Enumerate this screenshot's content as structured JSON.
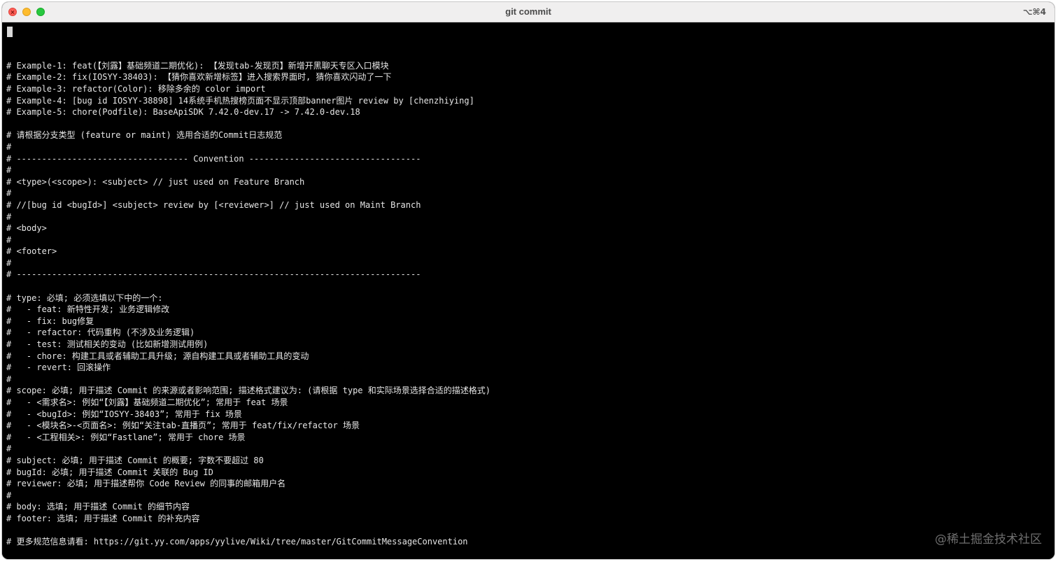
{
  "window": {
    "title": "git commit",
    "shortcut": "⌥⌘4"
  },
  "terminal": {
    "lines": [
      "",
      "",
      "# Example-1: feat(【刘露】基础频道二期优化): 【发现tab-发现页】新增开黑聊天专区入口模块",
      "# Example-2: fix(IOSYY-38403): 【猜你喜欢新增标签】进入搜索界面时, 猜你喜欢闪动了一下",
      "# Example-3: refactor(Color): 移除多余的 color import",
      "# Example-4: [bug id IOSYY-38898] 14系统手机热搜榜页面不显示顶部banner图片 review by [chenzhiying]",
      "# Example-5: chore(Podfile): BaseApiSDK 7.42.0-dev.17 -> 7.42.0-dev.18",
      "",
      "# 请根据分支类型 (feature or maint) 选用合适的Commit日志规范",
      "#",
      "# ---------------------------------- Convention ----------------------------------",
      "#",
      "# <type>(<scope>): <subject> // just used on Feature Branch",
      "#",
      "# //[bug id <bugId>] <subject> review by [<reviewer>] // just used on Maint Branch",
      "#",
      "# <body>",
      "#",
      "# <footer>",
      "#",
      "# --------------------------------------------------------------------------------",
      "",
      "# type: 必填; 必须选填以下中的一个:",
      "#   - feat: 新特性开发; 业务逻辑修改",
      "#   - fix: bug修复",
      "#   - refactor: 代码重构 (不涉及业务逻辑)",
      "#   - test: 测试相关的变动 (比如新增测试用例)",
      "#   - chore: 构建工具或者辅助工具升级; 源自构建工具或者辅助工具的变动",
      "#   - revert: 回滚操作",
      "#",
      "# scope: 必填; 用于描述 Commit 的来源或者影响范围; 描述格式建议为: (请根据 type 和实际场景选择合适的描述格式)",
      "#   - <需求名>: 例如“【刘露】基础频道二期优化”; 常用于 feat 场景",
      "#   - <bugId>: 例如“IOSYY-38403”; 常用于 fix 场景",
      "#   - <模块名>-<页面名>: 例如“关注tab-直播页”; 常用于 feat/fix/refactor 场景",
      "#   - <工程相关>: 例如“Fastlane”; 常用于 chore 场景",
      "#",
      "# subject: 必填; 用于描述 Commit 的概要; 字数不要超过 80",
      "# bugId: 必填; 用于描述 Commit 关联的 Bug ID",
      "# reviewer: 必填; 用于描述帮你 Code Review 的同事的邮箱用户名",
      "#",
      "# body: 选填; 用于描述 Commit 的细节内容",
      "# footer: 选填; 用于描述 Commit 的补充内容",
      "",
      "# 更多规范信息请看: https://git.yy.com/apps/yylive/Wiki/tree/master/GitCommitMessageConvention"
    ]
  },
  "watermark": "@稀土掘金技术社区"
}
